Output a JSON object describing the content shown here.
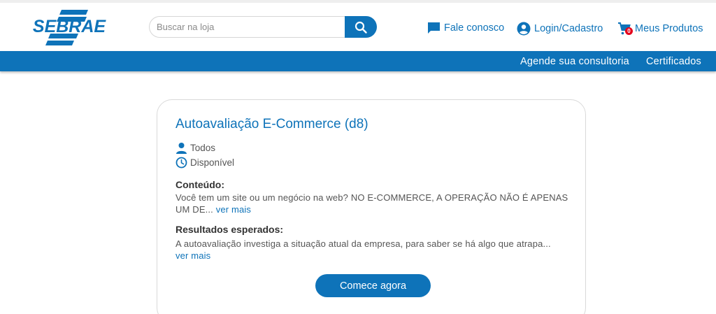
{
  "brand": {
    "name": "SEBRAE",
    "color": "#0e73b9"
  },
  "search": {
    "placeholder": "Buscar na loja",
    "value": "",
    "icon": "search-icon"
  },
  "header_links": {
    "contact": {
      "label": "Fale conosco",
      "icon": "chat-icon"
    },
    "login": {
      "label": "Login/Cadastro",
      "icon": "user-circle-icon"
    },
    "cart": {
      "label": "Meus Produtos",
      "icon": "cart-icon",
      "count": "0"
    }
  },
  "nav": {
    "items": [
      {
        "label": "Agende sua consultoria"
      },
      {
        "label": "Certificados"
      }
    ]
  },
  "product": {
    "title": "Autoavaliação E-Commerce (d8)",
    "audience": "Todos",
    "status": "Disponível",
    "content_label": "Conteúdo:",
    "content_text": "Você tem um site ou um negócio na web? NO E-COMMERCE, A OPERAÇÃO NÃO É APENAS UM DE...",
    "results_label": "Resultados esperados:",
    "results_text": "A autoavaliação investiga a situação atual da empresa, para saber se há algo que atrapa...",
    "more_label": "ver mais",
    "cta_label": "Comece agora"
  }
}
